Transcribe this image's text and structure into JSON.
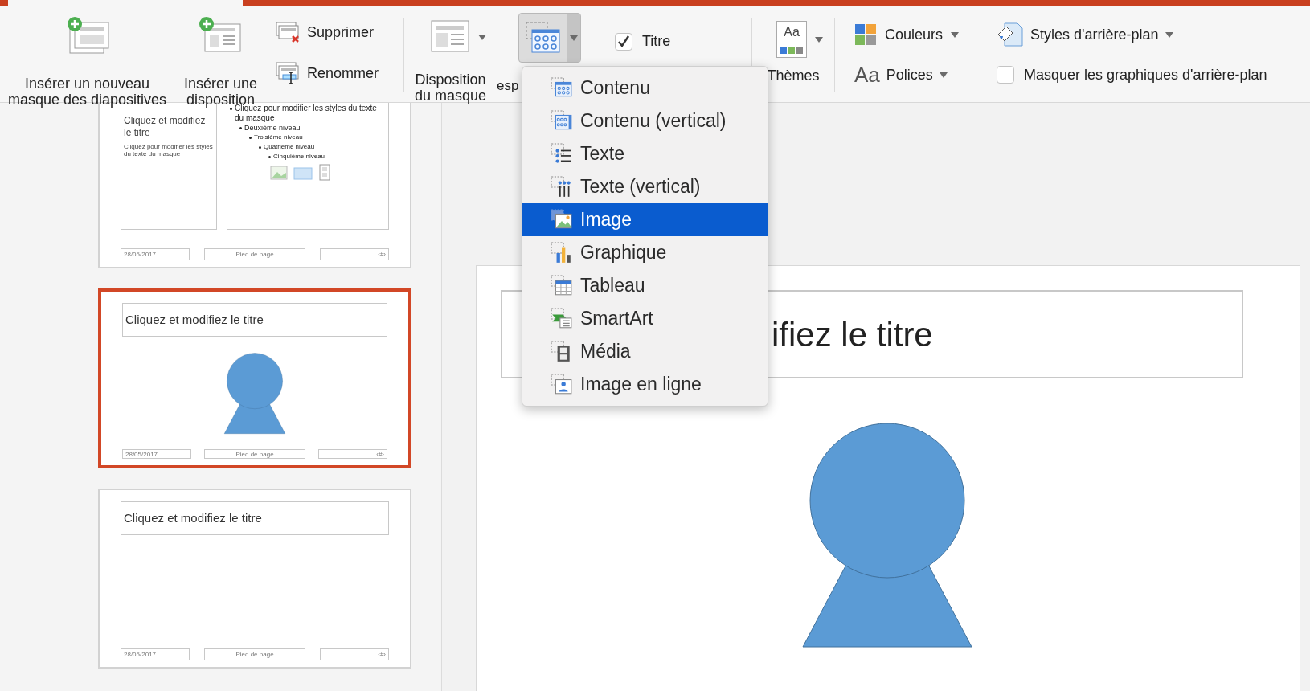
{
  "ribbon": {
    "large_buttons": [
      {
        "label": "Insérer un nouveau masque des diapositives",
        "kind": "master"
      },
      {
        "label": "Insérer une disposition",
        "kind": "layout"
      }
    ],
    "small_buttons": [
      {
        "label": "Supprimer",
        "kind": "delete"
      },
      {
        "label": "Renommer",
        "kind": "rename"
      }
    ],
    "master_layout": {
      "label": "Disposition du masque"
    },
    "placeholder": {
      "label": "esp",
      "open": true
    },
    "title_checkbox": {
      "label": "Titre",
      "checked": true
    },
    "themes": {
      "label": "Thèmes",
      "icon_text": "Aa"
    },
    "colors": {
      "label": "Couleurs"
    },
    "fonts": {
      "label": "Polices",
      "icon_text": "Aa"
    },
    "background_styles": {
      "label": "Styles d'arrière-plan"
    },
    "hide_background": {
      "label": "Masquer les graphiques d'arrière-plan",
      "checked": false
    }
  },
  "placeholder_menu": [
    {
      "label": "Contenu",
      "kind": "content",
      "selected": false
    },
    {
      "label": "Contenu (vertical)",
      "kind": "content-vertical",
      "selected": false
    },
    {
      "label": "Texte",
      "kind": "text",
      "selected": false
    },
    {
      "label": "Texte (vertical)",
      "kind": "text-vertical",
      "selected": false
    },
    {
      "label": "Image",
      "kind": "picture",
      "selected": true
    },
    {
      "label": "Graphique",
      "kind": "chart",
      "selected": false
    },
    {
      "label": "Tableau",
      "kind": "table",
      "selected": false
    },
    {
      "label": "SmartArt",
      "kind": "smartart",
      "selected": false
    },
    {
      "label": "Média",
      "kind": "media",
      "selected": false
    },
    {
      "label": "Image en ligne",
      "kind": "online-picture",
      "selected": false
    }
  ],
  "thumbnails": [
    {
      "kind": "vertical-title",
      "selected": false,
      "title": "Cliquez et modifiez le titre",
      "subtitle": "Cliquez pour modifier les styles du texte du masque",
      "bullets": [
        {
          "text": "Cliquez pour modifier les styles du texte du masque",
          "children": [
            {
              "text": "Deuxième niveau",
              "children": [
                {
                  "text": "Troisième niveau",
                  "children": [
                    {
                      "text": "Quatrième niveau",
                      "children": [
                        {
                          "text": "Cinquième niveau"
                        }
                      ]
                    }
                  ]
                }
              ]
            }
          ]
        }
      ],
      "footer": [
        "28/05/2017",
        "Pied de page",
        "‹#›"
      ]
    },
    {
      "kind": "picture",
      "selected": true,
      "title": "Cliquez et modifiez le titre",
      "footer": [
        "28/05/2017",
        "Pied de page",
        "‹#›"
      ]
    },
    {
      "kind": "title-only",
      "selected": false,
      "title": "Cliquez et modifiez le titre",
      "footer": [
        "28/05/2017",
        "Pied de page",
        "‹#›"
      ]
    }
  ],
  "slide": {
    "kind": "picture",
    "title": "ifiez le titre"
  }
}
